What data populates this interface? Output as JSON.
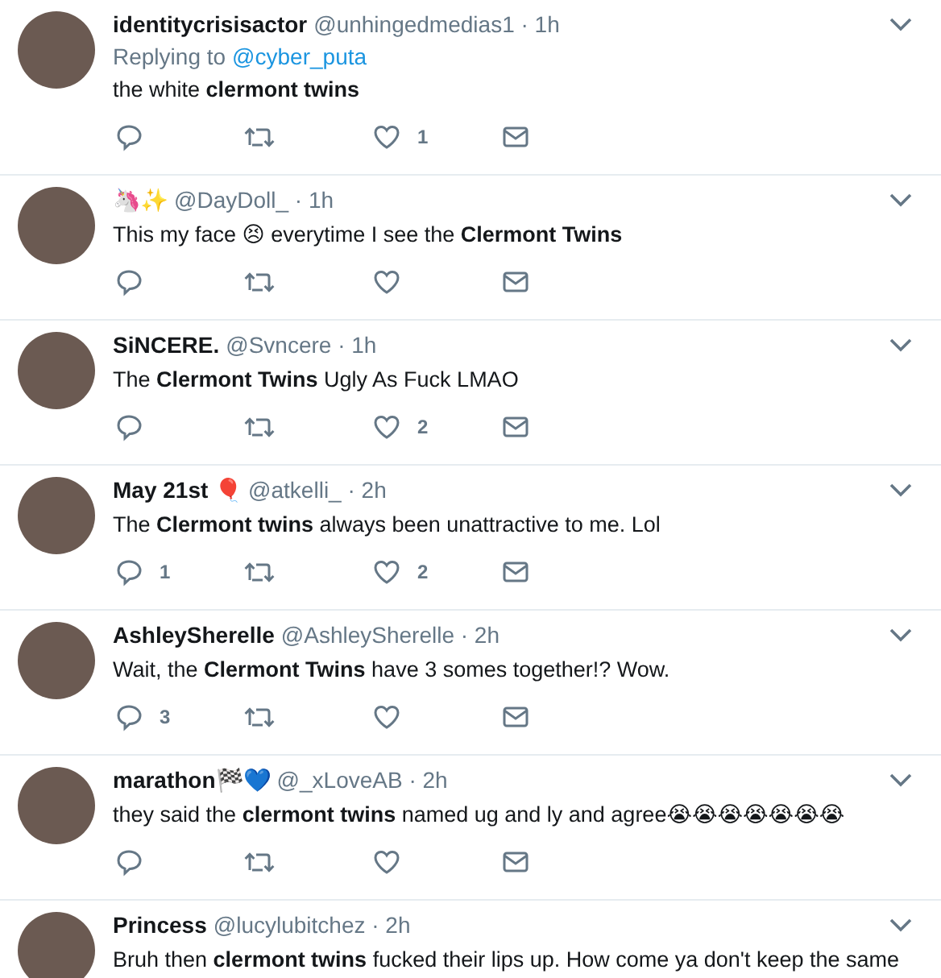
{
  "tweets": [
    {
      "name": "identitycrisisactor",
      "handle_time": "@unhingedmedias1 · 1h",
      "replying_label": "Replying to",
      "replying_to": "@cyber_puta",
      "text": "the white **clermont twins**",
      "likes": "1"
    },
    {
      "name": "🦄✨",
      "handle_time": "@DayDoll_ · 1h",
      "text": "This my face 😣 everytime I see the **Clermont Twins**"
    },
    {
      "name": "SiNCERE.",
      "handle_time": "@Svncere · 1h",
      "text": "The **Clermont Twins** Ugly As Fuck LMAO",
      "likes": "2"
    },
    {
      "name": "May 21st 🎈",
      "handle_time": "@atkelli_ · 2h",
      "text": "The **Clermont twins** always been unattractive to me. Lol",
      "replies": "1",
      "likes": "2"
    },
    {
      "name": "AshleySherelle",
      "handle_time": "@AshleySherelle · 2h",
      "text": "Wait, the **Clermont Twins** have 3 somes together!? Wow.",
      "replies": "3"
    },
    {
      "name": "marathon🏁💙",
      "handle_time": "@_xLoveAB · 2h",
      "text": "they said the **clermont twins** named ug and ly and agree😭😭😭😭😭😭😭"
    },
    {
      "name": "Princess",
      "handle_time": "@lucylubitchez · 2h",
      "text": "Bruh then **clermont twins** fucked their lips up. How come ya don't keep the same"
    }
  ]
}
